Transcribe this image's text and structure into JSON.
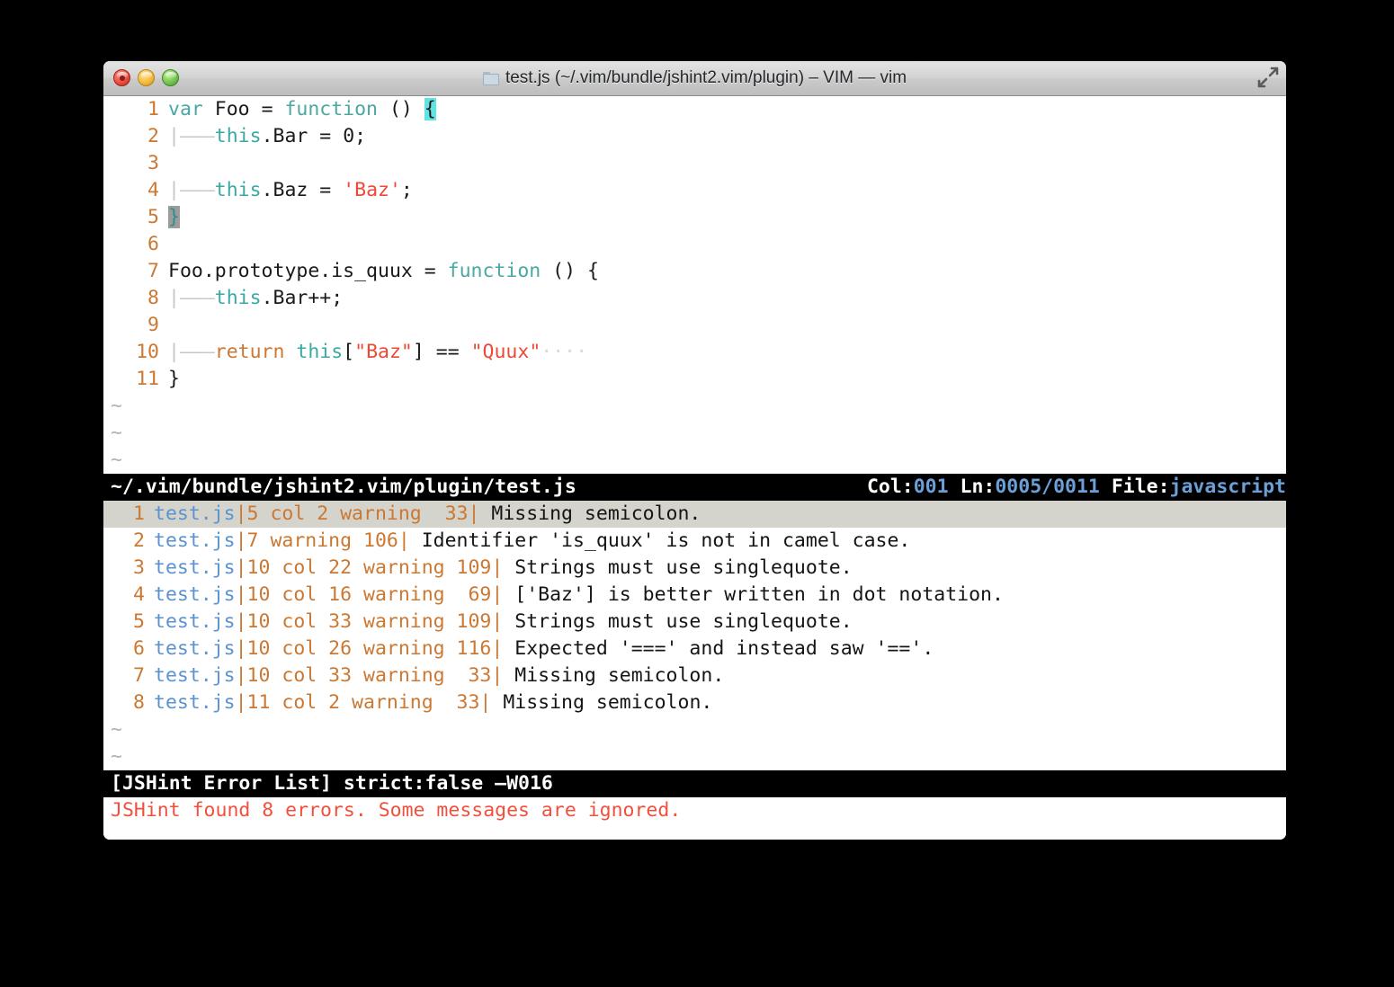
{
  "window": {
    "title": "test.js (~/.vim/bundle/jshint2.vim/plugin) – VIM — vim",
    "folder_icon": "folder-icon",
    "controls": {
      "close": "close-button",
      "minimize": "minimize-button",
      "zoom": "zoom-button",
      "fullscreen": "fullscreen-button"
    }
  },
  "editor": {
    "lines": [
      {
        "num": "1",
        "tokens": [
          {
            "t": "var ",
            "c": "kw"
          },
          {
            "t": "Foo ",
            "c": "ident"
          },
          {
            "t": "= ",
            "c": "punct"
          },
          {
            "t": "function ",
            "c": "kw"
          },
          {
            "t": "() ",
            "c": "punct"
          },
          {
            "t": "{",
            "c": "cursor-cyan"
          }
        ]
      },
      {
        "num": "2",
        "tokens": [
          {
            "t": "|———",
            "c": "indent"
          },
          {
            "t": "this",
            "c": "this"
          },
          {
            "t": ".Bar ",
            "c": "ident"
          },
          {
            "t": "= ",
            "c": "punct"
          },
          {
            "t": "0;",
            "c": "num"
          }
        ]
      },
      {
        "num": "3",
        "tokens": []
      },
      {
        "num": "4",
        "tokens": [
          {
            "t": "|———",
            "c": "indent"
          },
          {
            "t": "this",
            "c": "this"
          },
          {
            "t": ".Baz ",
            "c": "ident"
          },
          {
            "t": "= ",
            "c": "punct"
          },
          {
            "t": "'Baz'",
            "c": "str"
          },
          {
            "t": ";",
            "c": "punct"
          }
        ]
      },
      {
        "num": "5",
        "tokens": [
          {
            "t": "}",
            "c": "cursor-grey"
          }
        ]
      },
      {
        "num": "6",
        "tokens": []
      },
      {
        "num": "7",
        "tokens": [
          {
            "t": "Foo.prototype.is_quux ",
            "c": "ident"
          },
          {
            "t": "= ",
            "c": "punct"
          },
          {
            "t": "function ",
            "c": "kw"
          },
          {
            "t": "() {",
            "c": "punct"
          }
        ]
      },
      {
        "num": "8",
        "tokens": [
          {
            "t": "|———",
            "c": "indent"
          },
          {
            "t": "this",
            "c": "this"
          },
          {
            "t": ".Bar++;",
            "c": "ident"
          }
        ]
      },
      {
        "num": "9",
        "tokens": []
      },
      {
        "num": "10",
        "tokens": [
          {
            "t": "|———",
            "c": "indent"
          },
          {
            "t": "return ",
            "c": "ret"
          },
          {
            "t": "this",
            "c": "this"
          },
          {
            "t": "[",
            "c": "punct"
          },
          {
            "t": "\"Baz\"",
            "c": "str"
          },
          {
            "t": "] ",
            "c": "punct"
          },
          {
            "t": "== ",
            "c": "ident"
          },
          {
            "t": "\"Quux\"",
            "c": "str"
          },
          {
            "t": "····",
            "c": "trail"
          }
        ]
      },
      {
        "num": "11",
        "tokens": [
          {
            "t": "}",
            "c": "punct"
          }
        ]
      }
    ],
    "tildes": [
      "~",
      "~",
      "~"
    ]
  },
  "statusline_top": {
    "path": "~/.vim/bundle/jshint2.vim/plugin/test.js",
    "col_label": "Col:",
    "col_value": "001",
    "ln_label": "Ln:",
    "ln_value": "0005/0011",
    "file_label": "File:",
    "file_value": "javascript"
  },
  "errors": [
    {
      "num": "1",
      "file": "test.js",
      "loc": "|5 col 2 warning  33|",
      "msg": " Missing semicolon.",
      "selected": true
    },
    {
      "num": "2",
      "file": "test.js",
      "loc": "|7 warning 106|",
      "msg": " Identifier 'is_quux' is not in camel case.",
      "selected": false
    },
    {
      "num": "3",
      "file": "test.js",
      "loc": "|10 col 22 warning 109|",
      "msg": " Strings must use singlequote.",
      "selected": false
    },
    {
      "num": "4",
      "file": "test.js",
      "loc": "|10 col 16 warning  69|",
      "msg": " ['Baz'] is better written in dot notation.",
      "selected": false
    },
    {
      "num": "5",
      "file": "test.js",
      "loc": "|10 col 33 warning 109|",
      "msg": " Strings must use singlequote.",
      "selected": false
    },
    {
      "num": "6",
      "file": "test.js",
      "loc": "|10 col 26 warning 116|",
      "msg": " Expected '===' and instead saw '=='.",
      "selected": false
    },
    {
      "num": "7",
      "file": "test.js",
      "loc": "|10 col 33 warning  33|",
      "msg": " Missing semicolon.",
      "selected": false
    },
    {
      "num": "8",
      "file": "test.js",
      "loc": "|11 col 2 warning  33|",
      "msg": " Missing semicolon.",
      "selected": false
    }
  ],
  "errors_tildes": [
    "~",
    "~"
  ],
  "statusline_bottom": {
    "text": "[JSHint Error List] strict:false –W016"
  },
  "message": {
    "text": "JSHint found 8 errors. Some messages are ignored."
  },
  "colors": {
    "accent_orange": "#cb7832",
    "accent_teal": "#4aa8a3",
    "accent_blue": "#5b93d1",
    "string_red": "#ef4836",
    "message_red": "#f2503c",
    "cursor_cyan": "#5fe3e3",
    "cursor_grey": "#9c9c9c",
    "selection_grey": "#d4d4cc"
  }
}
